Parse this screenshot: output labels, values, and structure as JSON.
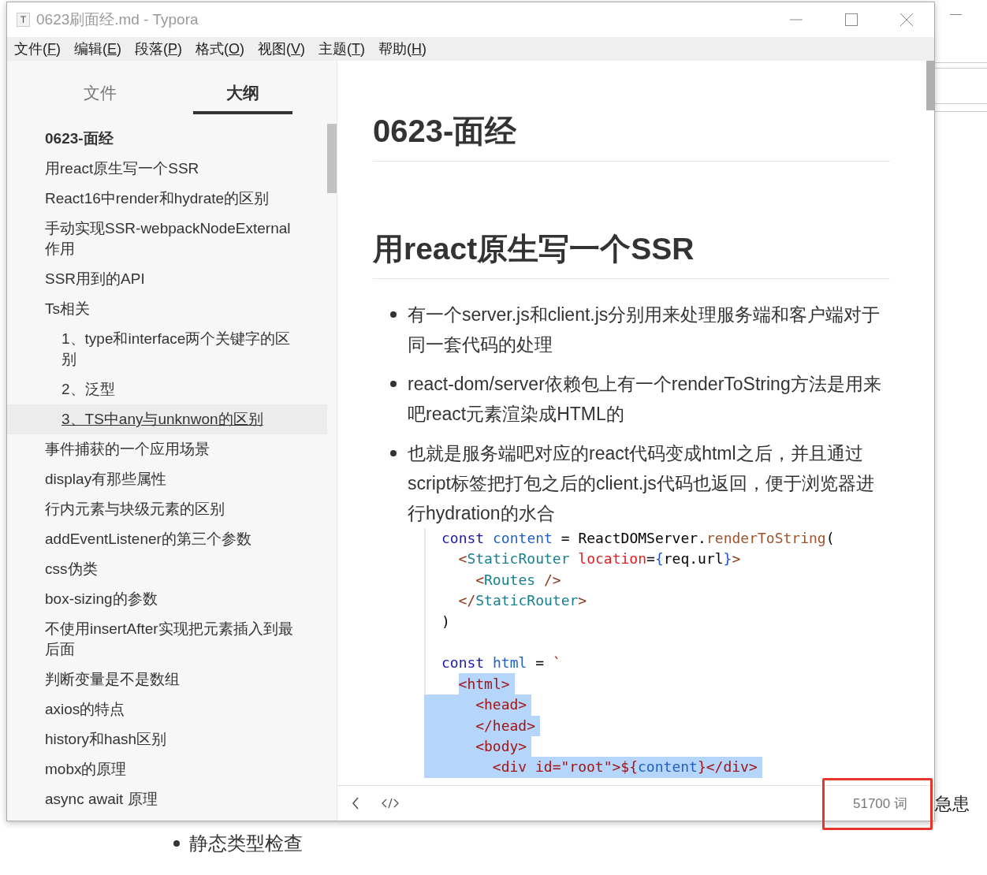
{
  "window": {
    "title": "0623刷面经.md - Typora"
  },
  "menu": [
    {
      "before": "文件(",
      "key": "F",
      "after": ")"
    },
    {
      "before": "编辑(",
      "key": "E",
      "after": ")"
    },
    {
      "before": "段落(",
      "key": "P",
      "after": ")"
    },
    {
      "before": "格式(",
      "key": "O",
      "after": ")"
    },
    {
      "before": "视图(",
      "key": "V",
      "after": ")"
    },
    {
      "before": "主题(",
      "key": "T",
      "after": ")"
    },
    {
      "before": "帮助(",
      "key": "H",
      "after": ")"
    }
  ],
  "sidebar": {
    "tabs": [
      {
        "label": "文件",
        "selected": false
      },
      {
        "label": "大纲",
        "selected": true
      }
    ],
    "outline": [
      {
        "label": "0623-面经",
        "kind": "title",
        "selected": false
      },
      {
        "label": "用react原生写一个SSR",
        "kind": "entry",
        "selected": false
      },
      {
        "label": "React16中render和hydrate的区别",
        "kind": "entry",
        "selected": false
      },
      {
        "label": "手动实现SSR-webpackNodeExternal作用",
        "kind": "entry",
        "selected": false
      },
      {
        "label": "SSR用到的API",
        "kind": "entry",
        "selected": false
      },
      {
        "label": "Ts相关",
        "kind": "entry",
        "selected": false,
        "children": [
          {
            "label": "1、type和interface两个关键字的区别",
            "kind": "entry",
            "selected": false
          },
          {
            "label": "2、泛型",
            "kind": "entry",
            "selected": false
          },
          {
            "label": "3、TS中any与unknwon的区别",
            "kind": "entry",
            "selected": true
          }
        ]
      },
      {
        "label": "事件捕获的一个应用场景",
        "kind": "entry",
        "selected": false
      },
      {
        "label": "display有那些属性",
        "kind": "entry",
        "selected": false
      },
      {
        "label": "行内元素与块级元素的区别",
        "kind": "entry",
        "selected": false
      },
      {
        "label": "addEventListener的第三个参数",
        "kind": "entry",
        "selected": false
      },
      {
        "label": "css伪类",
        "kind": "entry",
        "selected": false
      },
      {
        "label": "box-sizing的参数",
        "kind": "entry",
        "selected": false
      },
      {
        "label": "不使用insertAfter实现把元素插入到最后面",
        "kind": "entry",
        "selected": false
      },
      {
        "label": "判断变量是不是数组",
        "kind": "entry",
        "selected": false
      },
      {
        "label": "axios的特点",
        "kind": "entry",
        "selected": false
      },
      {
        "label": "history和hash区别",
        "kind": "entry",
        "selected": false
      },
      {
        "label": "mobx的原理",
        "kind": "entry",
        "selected": false
      },
      {
        "label": "async await 原理",
        "kind": "entry",
        "selected": false
      }
    ]
  },
  "editor": {
    "h1": "0623-面经",
    "h2": "用react原生写一个SSR",
    "bullets": [
      "有一个server.js和client.js分别用来处理服务端和客户端对于同一套代码的处理",
      "react-dom/server依赖包上有一个renderToString方法是用来吧react元素渲染成HTML的",
      "也就是服务端吧对应的react代码变成html之后，并且通过script标签把打包之后的client.js代码也返回，便于浏览器进行hydration的水合"
    ],
    "code": [
      {
        "kind": "code",
        "selected": false,
        "tokens": [
          {
            "text": "const ",
            "kind": "keyword"
          },
          {
            "text": "content",
            "kind": "def"
          },
          {
            "text": " = ReactDOMServer.",
            "kind": "plain"
          },
          {
            "text": "renderToString",
            "kind": "property"
          },
          {
            "text": "(",
            "kind": "plain"
          }
        ],
        "children": [
          {
            "kind": "code",
            "selected": false,
            "tokens": [
              {
                "text": "<",
                "kind": "bracket"
              },
              {
                "text": "StaticRouter",
                "kind": "tag"
              },
              {
                "text": " location",
                "kind": "attribute"
              },
              {
                "text": "=",
                "kind": "plain"
              },
              {
                "text": "{",
                "kind": "brace"
              },
              {
                "text": "req.url",
                "kind": "plain"
              },
              {
                "text": "}",
                "kind": "brace"
              },
              {
                "text": ">",
                "kind": "bracket"
              }
            ],
            "children": [
              {
                "kind": "code",
                "selected": false,
                "tokens": [
                  {
                    "text": "<",
                    "kind": "bracket"
                  },
                  {
                    "text": "Routes",
                    "kind": "tag"
                  },
                  {
                    "text": " />",
                    "kind": "bracket"
                  }
                ]
              }
            ]
          },
          {
            "kind": "code",
            "selected": false,
            "tokens": [
              {
                "text": "</",
                "kind": "bracket"
              },
              {
                "text": "StaticRouter",
                "kind": "tag"
              },
              {
                "text": ">",
                "kind": "bracket"
              }
            ]
          }
        ]
      },
      {
        "kind": "code",
        "selected": false,
        "tokens": [
          {
            "text": ")",
            "kind": "plain"
          }
        ]
      },
      {
        "kind": "blank"
      },
      {
        "kind": "code",
        "selected": false,
        "tokens": [
          {
            "text": "const ",
            "kind": "keyword"
          },
          {
            "text": "html",
            "kind": "def"
          },
          {
            "text": " = ",
            "kind": "plain"
          },
          {
            "text": "`",
            "kind": "string"
          }
        ],
        "children": [
          {
            "kind": "code",
            "selected": true,
            "tokens": [
              {
                "text": "<html>",
                "kind": "string"
              }
            ],
            "children": [
              {
                "kind": "code",
                "selected": true,
                "tokens": [
                  {
                    "text": "<head>",
                    "kind": "string"
                  }
                ]
              },
              {
                "kind": "code",
                "selected": true,
                "tokens": [
                  {
                    "text": "</head>",
                    "kind": "string"
                  }
                ]
              },
              {
                "kind": "code",
                "selected": true,
                "tokens": [
                  {
                    "text": "<body>",
                    "kind": "string"
                  }
                ],
                "children": [
                  {
                    "kind": "code",
                    "selected": true,
                    "tokens": [
                      {
                        "text": "<div id=\"root\">${",
                        "kind": "string"
                      },
                      {
                        "text": "content",
                        "kind": "def"
                      },
                      {
                        "text": "}</div>",
                        "kind": "string"
                      }
                    ]
                  }
                ]
              }
            ]
          }
        ]
      }
    ]
  },
  "status_bar": {
    "word_count": "51700 词"
  },
  "background": {
    "side_text": "急患",
    "bullet": "静态类型检查"
  }
}
